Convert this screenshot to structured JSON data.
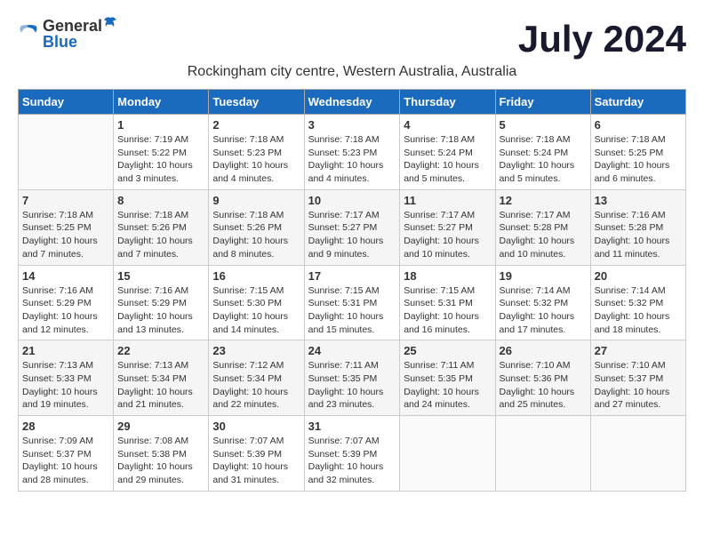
{
  "logo": {
    "text_general": "General",
    "text_blue": "Blue"
  },
  "month_title": "July 2024",
  "location": "Rockingham city centre, Western Australia, Australia",
  "days_header": [
    "Sunday",
    "Monday",
    "Tuesday",
    "Wednesday",
    "Thursday",
    "Friday",
    "Saturday"
  ],
  "weeks": [
    [
      {
        "day": "",
        "sunrise": "",
        "sunset": "",
        "daylight": "",
        "empty": true
      },
      {
        "day": "1",
        "sunrise": "Sunrise: 7:19 AM",
        "sunset": "Sunset: 5:22 PM",
        "daylight": "Daylight: 10 hours and 3 minutes."
      },
      {
        "day": "2",
        "sunrise": "Sunrise: 7:18 AM",
        "sunset": "Sunset: 5:23 PM",
        "daylight": "Daylight: 10 hours and 4 minutes."
      },
      {
        "day": "3",
        "sunrise": "Sunrise: 7:18 AM",
        "sunset": "Sunset: 5:23 PM",
        "daylight": "Daylight: 10 hours and 4 minutes."
      },
      {
        "day": "4",
        "sunrise": "Sunrise: 7:18 AM",
        "sunset": "Sunset: 5:24 PM",
        "daylight": "Daylight: 10 hours and 5 minutes."
      },
      {
        "day": "5",
        "sunrise": "Sunrise: 7:18 AM",
        "sunset": "Sunset: 5:24 PM",
        "daylight": "Daylight: 10 hours and 5 minutes."
      },
      {
        "day": "6",
        "sunrise": "Sunrise: 7:18 AM",
        "sunset": "Sunset: 5:25 PM",
        "daylight": "Daylight: 10 hours and 6 minutes."
      }
    ],
    [
      {
        "day": "7",
        "sunrise": "Sunrise: 7:18 AM",
        "sunset": "Sunset: 5:25 PM",
        "daylight": "Daylight: 10 hours and 7 minutes."
      },
      {
        "day": "8",
        "sunrise": "Sunrise: 7:18 AM",
        "sunset": "Sunset: 5:26 PM",
        "daylight": "Daylight: 10 hours and 7 minutes."
      },
      {
        "day": "9",
        "sunrise": "Sunrise: 7:18 AM",
        "sunset": "Sunset: 5:26 PM",
        "daylight": "Daylight: 10 hours and 8 minutes."
      },
      {
        "day": "10",
        "sunrise": "Sunrise: 7:17 AM",
        "sunset": "Sunset: 5:27 PM",
        "daylight": "Daylight: 10 hours and 9 minutes."
      },
      {
        "day": "11",
        "sunrise": "Sunrise: 7:17 AM",
        "sunset": "Sunset: 5:27 PM",
        "daylight": "Daylight: 10 hours and 10 minutes."
      },
      {
        "day": "12",
        "sunrise": "Sunrise: 7:17 AM",
        "sunset": "Sunset: 5:28 PM",
        "daylight": "Daylight: 10 hours and 10 minutes."
      },
      {
        "day": "13",
        "sunrise": "Sunrise: 7:16 AM",
        "sunset": "Sunset: 5:28 PM",
        "daylight": "Daylight: 10 hours and 11 minutes."
      }
    ],
    [
      {
        "day": "14",
        "sunrise": "Sunrise: 7:16 AM",
        "sunset": "Sunset: 5:29 PM",
        "daylight": "Daylight: 10 hours and 12 minutes."
      },
      {
        "day": "15",
        "sunrise": "Sunrise: 7:16 AM",
        "sunset": "Sunset: 5:29 PM",
        "daylight": "Daylight: 10 hours and 13 minutes."
      },
      {
        "day": "16",
        "sunrise": "Sunrise: 7:15 AM",
        "sunset": "Sunset: 5:30 PM",
        "daylight": "Daylight: 10 hours and 14 minutes."
      },
      {
        "day": "17",
        "sunrise": "Sunrise: 7:15 AM",
        "sunset": "Sunset: 5:31 PM",
        "daylight": "Daylight: 10 hours and 15 minutes."
      },
      {
        "day": "18",
        "sunrise": "Sunrise: 7:15 AM",
        "sunset": "Sunset: 5:31 PM",
        "daylight": "Daylight: 10 hours and 16 minutes."
      },
      {
        "day": "19",
        "sunrise": "Sunrise: 7:14 AM",
        "sunset": "Sunset: 5:32 PM",
        "daylight": "Daylight: 10 hours and 17 minutes."
      },
      {
        "day": "20",
        "sunrise": "Sunrise: 7:14 AM",
        "sunset": "Sunset: 5:32 PM",
        "daylight": "Daylight: 10 hours and 18 minutes."
      }
    ],
    [
      {
        "day": "21",
        "sunrise": "Sunrise: 7:13 AM",
        "sunset": "Sunset: 5:33 PM",
        "daylight": "Daylight: 10 hours and 19 minutes."
      },
      {
        "day": "22",
        "sunrise": "Sunrise: 7:13 AM",
        "sunset": "Sunset: 5:34 PM",
        "daylight": "Daylight: 10 hours and 21 minutes."
      },
      {
        "day": "23",
        "sunrise": "Sunrise: 7:12 AM",
        "sunset": "Sunset: 5:34 PM",
        "daylight": "Daylight: 10 hours and 22 minutes."
      },
      {
        "day": "24",
        "sunrise": "Sunrise: 7:11 AM",
        "sunset": "Sunset: 5:35 PM",
        "daylight": "Daylight: 10 hours and 23 minutes."
      },
      {
        "day": "25",
        "sunrise": "Sunrise: 7:11 AM",
        "sunset": "Sunset: 5:35 PM",
        "daylight": "Daylight: 10 hours and 24 minutes."
      },
      {
        "day": "26",
        "sunrise": "Sunrise: 7:10 AM",
        "sunset": "Sunset: 5:36 PM",
        "daylight": "Daylight: 10 hours and 25 minutes."
      },
      {
        "day": "27",
        "sunrise": "Sunrise: 7:10 AM",
        "sunset": "Sunset: 5:37 PM",
        "daylight": "Daylight: 10 hours and 27 minutes."
      }
    ],
    [
      {
        "day": "28",
        "sunrise": "Sunrise: 7:09 AM",
        "sunset": "Sunset: 5:37 PM",
        "daylight": "Daylight: 10 hours and 28 minutes."
      },
      {
        "day": "29",
        "sunrise": "Sunrise: 7:08 AM",
        "sunset": "Sunset: 5:38 PM",
        "daylight": "Daylight: 10 hours and 29 minutes."
      },
      {
        "day": "30",
        "sunrise": "Sunrise: 7:07 AM",
        "sunset": "Sunset: 5:39 PM",
        "daylight": "Daylight: 10 hours and 31 minutes."
      },
      {
        "day": "31",
        "sunrise": "Sunrise: 7:07 AM",
        "sunset": "Sunset: 5:39 PM",
        "daylight": "Daylight: 10 hours and 32 minutes."
      },
      {
        "day": "",
        "sunrise": "",
        "sunset": "",
        "daylight": "",
        "empty": true
      },
      {
        "day": "",
        "sunrise": "",
        "sunset": "",
        "daylight": "",
        "empty": true
      },
      {
        "day": "",
        "sunrise": "",
        "sunset": "",
        "daylight": "",
        "empty": true
      }
    ]
  ]
}
